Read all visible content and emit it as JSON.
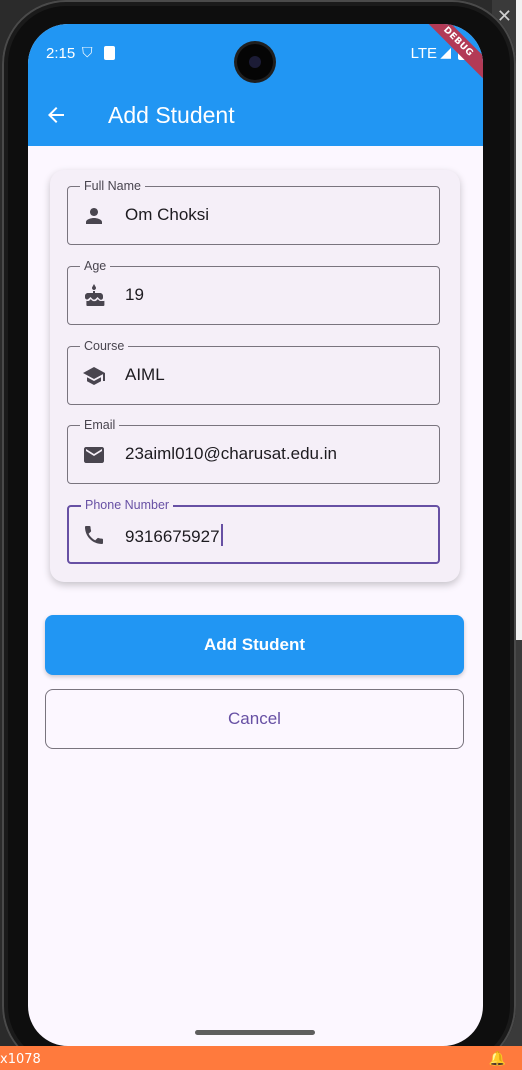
{
  "host": {
    "resolution_fragment": "x1078"
  },
  "status_bar": {
    "time": "2:15",
    "network": "LTE",
    "debug_banner": "DEBUG"
  },
  "app_bar": {
    "title": "Add Student"
  },
  "form": {
    "fields": [
      {
        "label": "Full Name",
        "value": "Om Choksi",
        "icon": "person-icon"
      },
      {
        "label": "Age",
        "value": "19",
        "icon": "cake-icon"
      },
      {
        "label": "Course",
        "value": "AIML",
        "icon": "school-icon"
      },
      {
        "label": "Email",
        "value": "23aiml010@charusat.edu.in",
        "icon": "email-icon"
      },
      {
        "label": "Phone Number",
        "value": "9316675927",
        "icon": "phone-icon",
        "focused": true
      }
    ]
  },
  "actions": {
    "submit_label": "Add Student",
    "cancel_label": "Cancel"
  },
  "colors": {
    "primary": "#2196f3",
    "accent": "#6750a4",
    "background": "#fcf7ff",
    "card": "#f5eff8"
  }
}
